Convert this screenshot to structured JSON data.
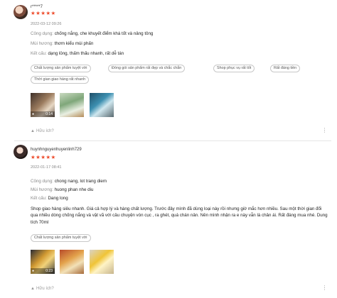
{
  "reviews": [
    {
      "username": "r*****7",
      "rating_text": "★★★★★",
      "rating": 5,
      "meta": "2022-03-12 09:26",
      "attributes": [
        {
          "label": "Công dụng:",
          "value": "chống nắng, che khuyết điểm khá tốt và nâng tông"
        },
        {
          "label": "Mùi hương:",
          "value": "thơm kiểu mùi phấn"
        },
        {
          "label": "Kết cấu:",
          "value": "dạng lỏng, thấm thấu nhanh, rất dễ tán"
        }
      ],
      "tags": [
        "Chất lượng sản phẩm tuyệt vời",
        "Đóng gói sản phẩm rất đẹp và chắc chắn",
        "Shop phục vụ rất tốt",
        "Rất đáng tiền",
        "Thời gian giao hàng rất nhanh"
      ],
      "media": [
        {
          "type": "video",
          "camera_icon": "video-camera-icon",
          "duration": "0:14"
        },
        {
          "type": "image"
        },
        {
          "type": "image"
        }
      ],
      "helpful_label": "Hữu ích?",
      "more_icon": "more-options-icon"
    },
    {
      "username": "huynhnguyenhuyenlinh729",
      "rating_text": "★★★★★",
      "rating": 5,
      "meta": "2022-01-17 08:41",
      "attributes": [
        {
          "label": "Công dụng:",
          "value": "chong nang, lot trang diem"
        },
        {
          "label": "Mùi hương:",
          "value": "huong phan nhe diu"
        },
        {
          "label": "Kết cấu:",
          "value": "Dang long"
        }
      ],
      "comment": "Shop giao hàng siêu nhanh. Giá cả hợp lý và hàng chất lượng. Trước đây mình đã dùng loại này rồi nhưng giờ mắc hơn nhiều. Sau một thời gian đổi qua nhiều dòng chống nắng và vật vã với câu chuyện vón cục , ra ghét, quá chán nản. Nên mình nhận ra e này vẫn là chân ái. Rất đáng mua nhé. Dung tích 70ml",
      "tags": [
        "Chất lượng sản phẩm tuyệt vời"
      ],
      "media": [
        {
          "type": "video",
          "camera_icon": "video-camera-icon",
          "duration": "0:23"
        },
        {
          "type": "image"
        },
        {
          "type": "image"
        }
      ],
      "helpful_label": "Hữu ích?",
      "more_icon": "more-options-icon"
    }
  ],
  "colors": {
    "star": "#ee4d2d",
    "muted_text": "#888888",
    "chip_border": "#c8c8c8"
  }
}
